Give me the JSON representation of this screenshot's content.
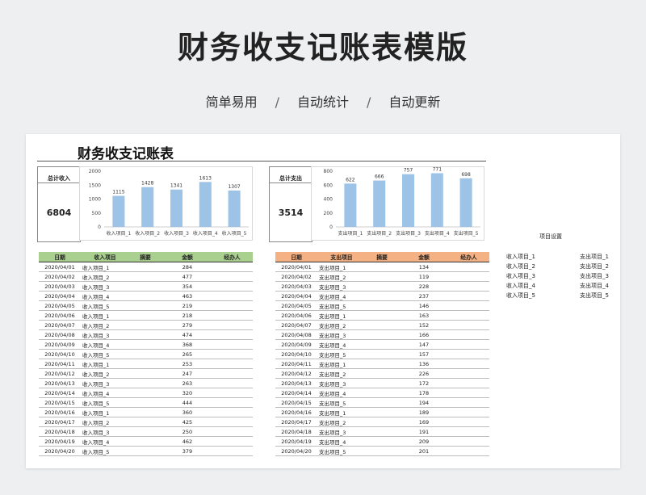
{
  "header": {
    "title": "财务收支记账表模版",
    "tags": [
      "简单易用",
      "自动统计",
      "自动更新"
    ],
    "separator": "/"
  },
  "sheet": {
    "title": "财务收支记账表",
    "income_kpi": {
      "label": "总计收入",
      "value": "6804"
    },
    "expense_kpi": {
      "label": "总计支出",
      "value": "3514"
    },
    "settings": {
      "title": "项目设置",
      "income_items": [
        "收入项目_1",
        "收入项目_2",
        "收入项目_3",
        "收入项目_4",
        "收入项目_5"
      ],
      "expense_items": [
        "支出项目_1",
        "支出项目_2",
        "支出项目_3",
        "支出项目_4",
        "支出项目_5"
      ]
    },
    "income_table": {
      "header_color": "#a9d08e",
      "headers": [
        "日期",
        "收入项目",
        "摘要",
        "金额",
        "经办人"
      ],
      "rows": [
        [
          "2020/04/01",
          "收入项目_1",
          "",
          "284",
          ""
        ],
        [
          "2020/04/02",
          "收入项目_2",
          "",
          "477",
          ""
        ],
        [
          "2020/04/03",
          "收入项目_3",
          "",
          "354",
          ""
        ],
        [
          "2020/04/04",
          "收入项目_4",
          "",
          "463",
          ""
        ],
        [
          "2020/04/05",
          "收入项目_5",
          "",
          "219",
          ""
        ],
        [
          "2020/04/06",
          "收入项目_1",
          "",
          "218",
          ""
        ],
        [
          "2020/04/07",
          "收入项目_2",
          "",
          "279",
          ""
        ],
        [
          "2020/04/08",
          "收入项目_3",
          "",
          "474",
          ""
        ],
        [
          "2020/04/09",
          "收入项目_4",
          "",
          "368",
          ""
        ],
        [
          "2020/04/10",
          "收入项目_5",
          "",
          "265",
          ""
        ],
        [
          "2020/04/11",
          "收入项目_1",
          "",
          "253",
          ""
        ],
        [
          "2020/04/12",
          "收入项目_2",
          "",
          "247",
          ""
        ],
        [
          "2020/04/13",
          "收入项目_3",
          "",
          "263",
          ""
        ],
        [
          "2020/04/14",
          "收入项目_4",
          "",
          "320",
          ""
        ],
        [
          "2020/04/15",
          "收入项目_5",
          "",
          "444",
          ""
        ],
        [
          "2020/04/16",
          "收入项目_1",
          "",
          "360",
          ""
        ],
        [
          "2020/04/17",
          "收入项目_2",
          "",
          "425",
          ""
        ],
        [
          "2020/04/18",
          "收入项目_3",
          "",
          "250",
          ""
        ],
        [
          "2020/04/19",
          "收入项目_4",
          "",
          "462",
          ""
        ],
        [
          "2020/04/20",
          "收入项目_5",
          "",
          "379",
          ""
        ]
      ]
    },
    "expense_table": {
      "header_color": "#f4b183",
      "headers": [
        "日期",
        "支出项目",
        "摘要",
        "金额",
        "经办人"
      ],
      "rows": [
        [
          "2020/04/01",
          "支出项目_1",
          "",
          "134",
          ""
        ],
        [
          "2020/04/02",
          "支出项目_2",
          "",
          "119",
          ""
        ],
        [
          "2020/04/03",
          "支出项目_3",
          "",
          "228",
          ""
        ],
        [
          "2020/04/04",
          "支出项目_4",
          "",
          "237",
          ""
        ],
        [
          "2020/04/05",
          "支出项目_5",
          "",
          "146",
          ""
        ],
        [
          "2020/04/06",
          "支出项目_1",
          "",
          "163",
          ""
        ],
        [
          "2020/04/07",
          "支出项目_2",
          "",
          "152",
          ""
        ],
        [
          "2020/04/08",
          "支出项目_3",
          "",
          "166",
          ""
        ],
        [
          "2020/04/09",
          "支出项目_4",
          "",
          "147",
          ""
        ],
        [
          "2020/04/10",
          "支出项目_5",
          "",
          "157",
          ""
        ],
        [
          "2020/04/11",
          "支出项目_1",
          "",
          "136",
          ""
        ],
        [
          "2020/04/12",
          "支出项目_2",
          "",
          "226",
          ""
        ],
        [
          "2020/04/13",
          "支出项目_3",
          "",
          "172",
          ""
        ],
        [
          "2020/04/14",
          "支出项目_4",
          "",
          "178",
          ""
        ],
        [
          "2020/04/15",
          "支出项目_5",
          "",
          "194",
          ""
        ],
        [
          "2020/04/16",
          "支出项目_1",
          "",
          "189",
          ""
        ],
        [
          "2020/04/17",
          "支出项目_2",
          "",
          "169",
          ""
        ],
        [
          "2020/04/18",
          "支出项目_3",
          "",
          "191",
          ""
        ],
        [
          "2020/04/19",
          "支出项目_4",
          "",
          "209",
          ""
        ],
        [
          "2020/04/20",
          "支出项目_5",
          "",
          "201",
          ""
        ]
      ]
    }
  },
  "chart_data": [
    {
      "type": "bar",
      "categories": [
        "收入项目_1",
        "收入项目_2",
        "收入项目_3",
        "收入项目_4",
        "收入项目_5"
      ],
      "values": [
        1115,
        1428,
        1341,
        1613,
        1307
      ],
      "ylim": [
        0,
        2000
      ],
      "yticks": [
        0,
        500,
        1000,
        1500,
        2000
      ],
      "bar_color": "#9dc3e6",
      "grid": false
    },
    {
      "type": "bar",
      "categories": [
        "支出项目_1",
        "支出项目_2",
        "支出项目_3",
        "支出项目_4",
        "支出项目_5"
      ],
      "values": [
        622,
        666,
        757,
        771,
        698
      ],
      "ylim": [
        0,
        800
      ],
      "yticks": [
        0,
        200,
        400,
        600,
        800
      ],
      "bar_color": "#9dc3e6",
      "grid": false
    }
  ]
}
